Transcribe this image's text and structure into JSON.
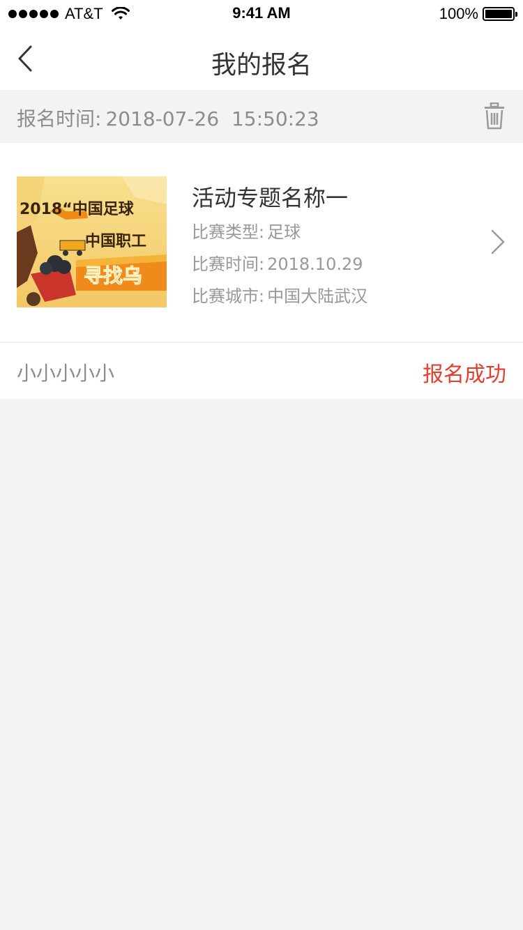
{
  "status_bar": {
    "carrier": "AT&T",
    "time": "9:41 AM",
    "battery": "100%",
    "battery_level": 1.0
  },
  "nav": {
    "title": "我的报名",
    "back_icon": "chevron-left-icon"
  },
  "registration": {
    "time_label": "报名时间:",
    "time_value": "2018-07-26  15:50:23",
    "delete_icon": "trash-icon"
  },
  "item": {
    "title": "活动专题名称一",
    "thumbnail_text": [
      "2018“中国足球",
      "中国职工",
      "寻找乌"
    ],
    "type_label": "比赛类型:",
    "type_value": "足球",
    "date_label": "比赛时间:",
    "date_value": "2018.10.29",
    "city_label": "比赛城市:",
    "city_value": "中国大陆武汉"
  },
  "footer": {
    "name": "小小小小小",
    "status": "报名成功"
  },
  "colors": {
    "accent_red": "#e53e30",
    "background": "#f2f3f5",
    "text_primary": "#333333",
    "text_secondary": "#999999"
  }
}
